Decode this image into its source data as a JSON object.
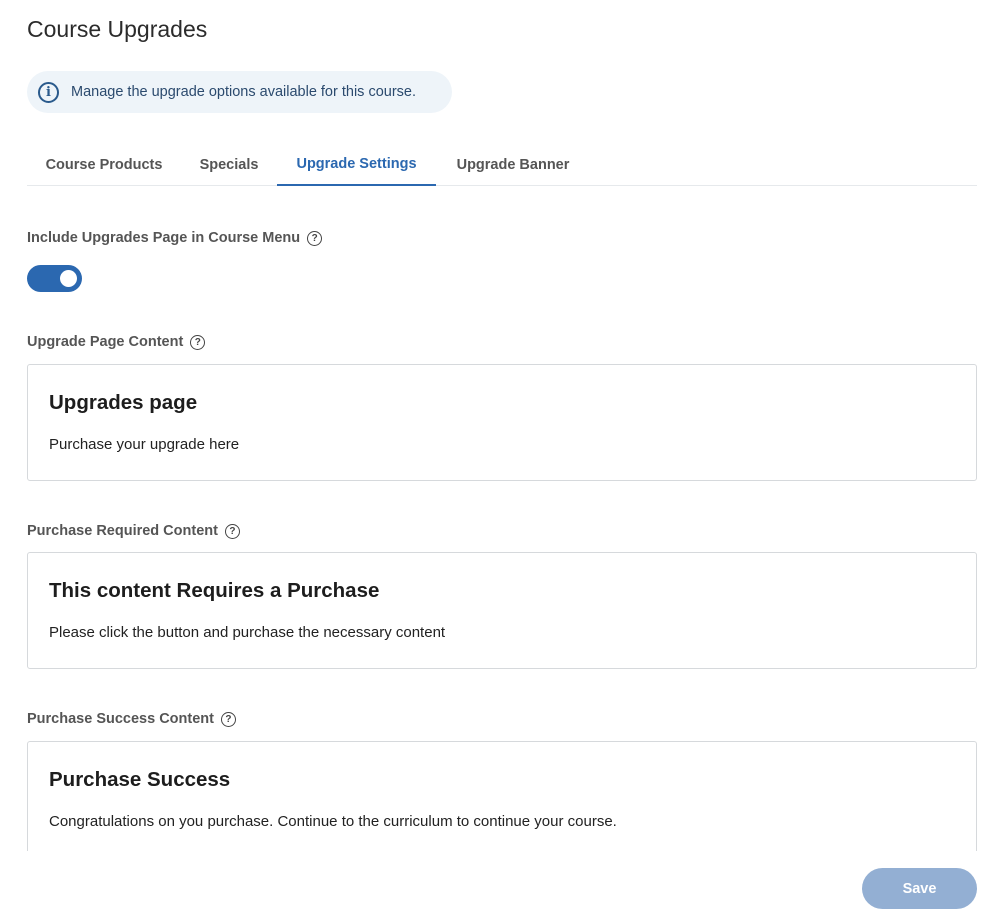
{
  "page": {
    "title": "Course Upgrades"
  },
  "info_banner": {
    "icon": "info-icon",
    "text": "Manage the upgrade options available for this course."
  },
  "tabs": [
    {
      "label": "Course Products",
      "active": false
    },
    {
      "label": "Specials",
      "active": false
    },
    {
      "label": "Upgrade Settings",
      "active": true
    },
    {
      "label": "Upgrade Banner",
      "active": false
    }
  ],
  "settings": {
    "include_menu": {
      "label": "Include Upgrades Page in Course Menu",
      "enabled": true
    },
    "upgrade_page": {
      "label": "Upgrade Page Content",
      "heading": "Upgrades page",
      "body": "Purchase your upgrade here"
    },
    "purchase_required": {
      "label": "Purchase Required Content",
      "heading": "This content Requires a Purchase",
      "body": "Please click the button and purchase the necessary content"
    },
    "purchase_success": {
      "label": "Purchase Success Content",
      "heading": "Purchase Success",
      "body": "Congratulations on you purchase. Continue to the curriculum to continue your course."
    }
  },
  "actions": {
    "save_label": "Save"
  },
  "colors": {
    "accent": "#2b68b0",
    "save_disabled": "#93afd3",
    "banner_bg": "#eef4f9"
  }
}
